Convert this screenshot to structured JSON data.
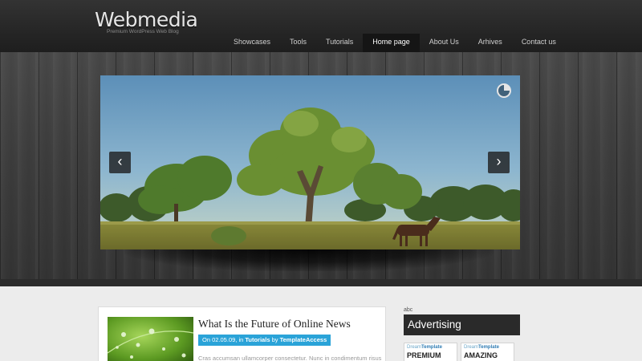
{
  "header": {
    "logo": "Webmedia",
    "tagline": "Premium WordPress Web Blog"
  },
  "nav": {
    "items": [
      {
        "label": "Showcases"
      },
      {
        "label": "Tools"
      },
      {
        "label": "Tutorials"
      },
      {
        "label": "Home page"
      },
      {
        "label": "About Us"
      },
      {
        "label": "Arhives"
      },
      {
        "label": "Contact us"
      }
    ],
    "active": "Home page"
  },
  "slider": {
    "prev_icon": "chevron-left-icon",
    "next_icon": "chevron-right-icon",
    "prev_glyph": "‹",
    "next_glyph": "›",
    "timer_icon": "pie-timer-icon"
  },
  "post": {
    "title": "What Is the Future of Online News",
    "date_prefix": "On 02.05.09, in ",
    "category": "Tutorials",
    "by": " by ",
    "author": "TemplateAccess",
    "excerpt": "Cras accumsan ullamcorper consectetur. Nunc in condimentum risus"
  },
  "sidebar": {
    "small_label": "abc",
    "ad_title": "Advertising",
    "ads": [
      {
        "brand_a": "Dream",
        "brand_b": "Template",
        "word": "PREMIUM"
      },
      {
        "brand_a": "Dream",
        "brand_b": "Template",
        "word": "AMAZING"
      }
    ]
  },
  "colors": {
    "accent": "#2aa3d8",
    "header": "#262626",
    "nav_active": "#151515"
  }
}
